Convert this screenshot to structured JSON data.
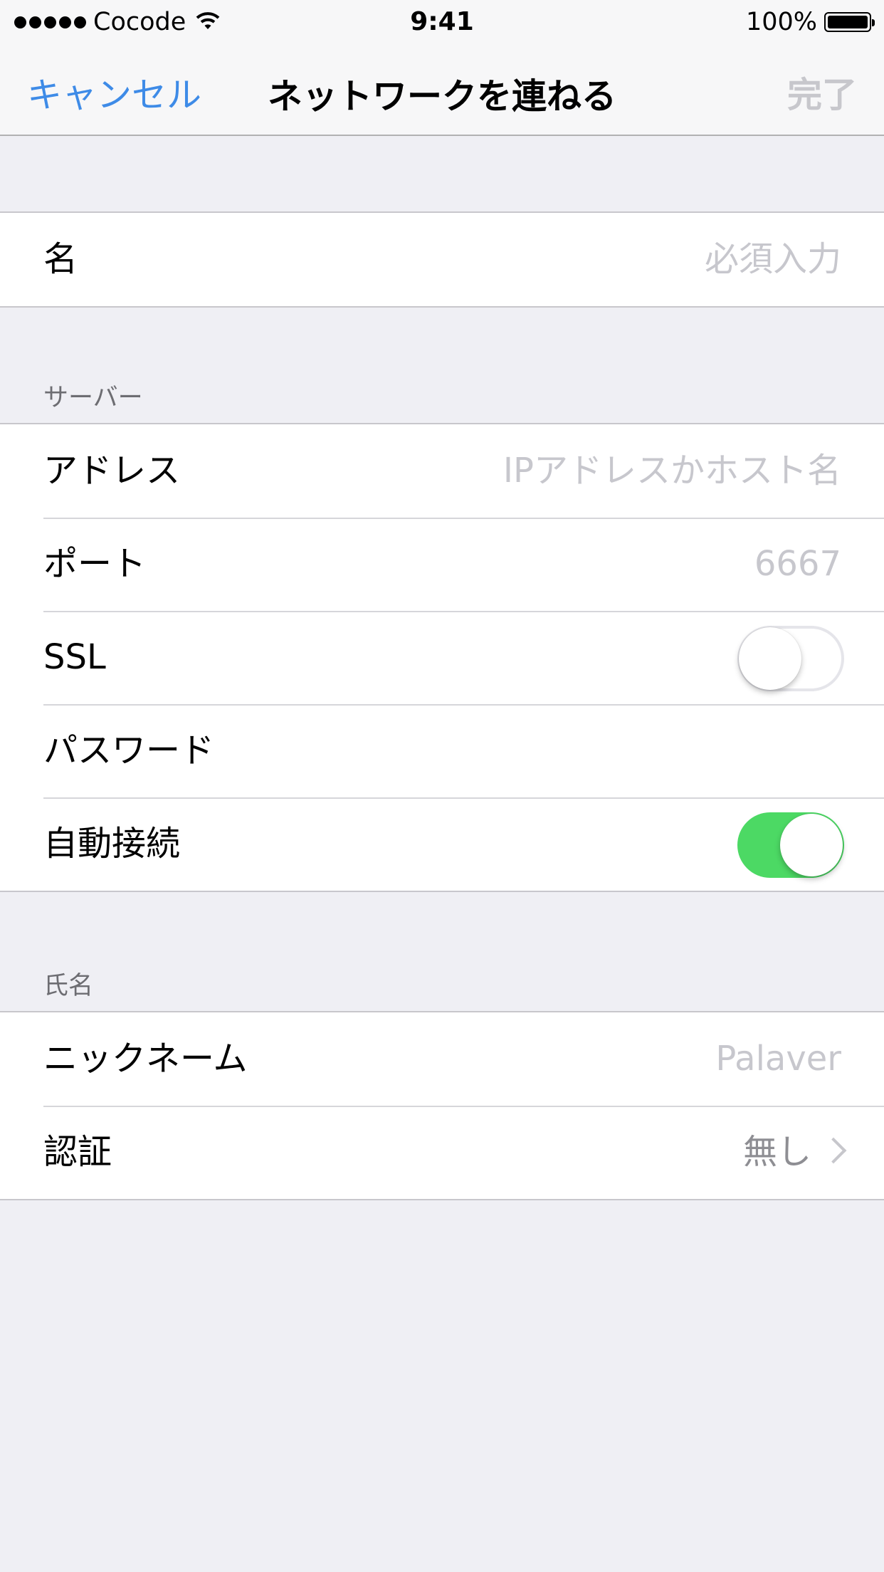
{
  "status_bar": {
    "carrier": "Cocode",
    "time": "9:41",
    "battery": "100%"
  },
  "nav": {
    "cancel": "キャンセル",
    "title": "ネットワークを連ねる",
    "done": "完了"
  },
  "name_group": {
    "label": "名",
    "placeholder": "必須入力"
  },
  "server_section": {
    "header": "サーバー",
    "address": {
      "label": "アドレス",
      "placeholder": "IPアドレスかホスト名"
    },
    "port": {
      "label": "ポート",
      "placeholder": "6667"
    },
    "ssl": {
      "label": "SSL",
      "enabled": false
    },
    "password": {
      "label": "パスワード"
    },
    "auto_connect": {
      "label": "自動接続",
      "enabled": true
    }
  },
  "identity_section": {
    "header": "氏名",
    "nickname": {
      "label": "ニックネーム",
      "placeholder": "Palaver"
    },
    "auth": {
      "label": "認証",
      "value": "無し"
    }
  },
  "colors": {
    "accent": "#3e8be7",
    "switch_on": "#4cd964",
    "background": "#efeff4"
  }
}
